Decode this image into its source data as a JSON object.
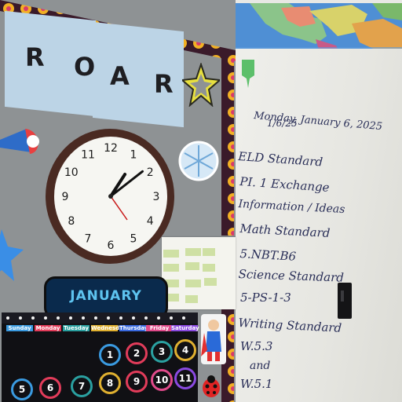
{
  "board": {
    "roar_letters": [
      "R",
      "O",
      "A",
      "R"
    ]
  },
  "month_banner": "JANUARY",
  "calendar": {
    "weekdays": [
      "Sunday",
      "Monday",
      "Tuesday",
      "Wednesday",
      "Thursday",
      "Friday",
      "Saturday"
    ],
    "dates_row1": [
      "1",
      "2",
      "3",
      "4"
    ],
    "dates_row2": [
      "5",
      "6",
      "7",
      "8",
      "9",
      "10",
      "11"
    ]
  },
  "clock": {
    "numerals": [
      "12",
      "1",
      "2",
      "3",
      "4",
      "5",
      "6",
      "7",
      "8",
      "9",
      "10",
      "11"
    ],
    "hour": 1,
    "minute": 9
  },
  "whiteboard": {
    "lines": [
      "Monday, January 6, 2025",
      "1/6/25",
      "ELD Standard",
      "PI. 1 Exchange",
      "Information / Ideas",
      "Math Standard",
      "5.NBT.B6",
      "Science Standard",
      "5-PS-1-3",
      "Writing Standard",
      "W.5.3",
      "and",
      "W.5.1"
    ]
  },
  "colors": {
    "board_gray": "#8e9294",
    "calendar_black": "#101014",
    "banner_blue": "#0a2a4c",
    "marker_blue": "#2a2f58"
  }
}
